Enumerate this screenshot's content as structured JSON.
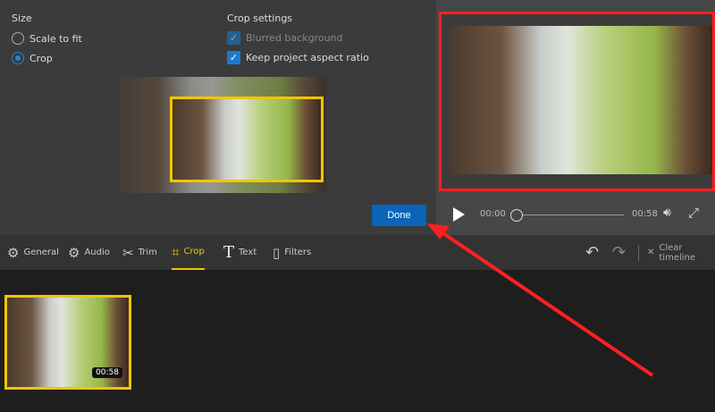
{
  "size": {
    "title": "Size",
    "options": [
      {
        "label": "Scale to fit",
        "selected": false
      },
      {
        "label": "Crop",
        "selected": true
      }
    ]
  },
  "crop_settings": {
    "title": "Crop settings",
    "options": [
      {
        "label": "Blurred background",
        "checked": true,
        "disabled": true
      },
      {
        "label": "Keep project aspect ratio",
        "checked": true,
        "disabled": false
      }
    ]
  },
  "done_label": "Done",
  "player": {
    "current_time": "00:00",
    "duration": "00:58",
    "progress": 0
  },
  "tabs": [
    {
      "label": "General",
      "icon": "gear-icon"
    },
    {
      "label": "Audio",
      "icon": "gear-icon"
    },
    {
      "label": "Trim",
      "icon": "scissors-icon"
    },
    {
      "label": "Crop",
      "icon": "crop-icon",
      "active": true
    },
    {
      "label": "Text",
      "icon": "text-icon"
    },
    {
      "label": "Filters",
      "icon": "filters-icon"
    }
  ],
  "clear_timeline_label": "Clear timeline",
  "clip": {
    "duration": "00:58"
  },
  "colors": {
    "accent": "#f2c500",
    "blue": "#0a64b8",
    "highlight": "#ff2020"
  }
}
